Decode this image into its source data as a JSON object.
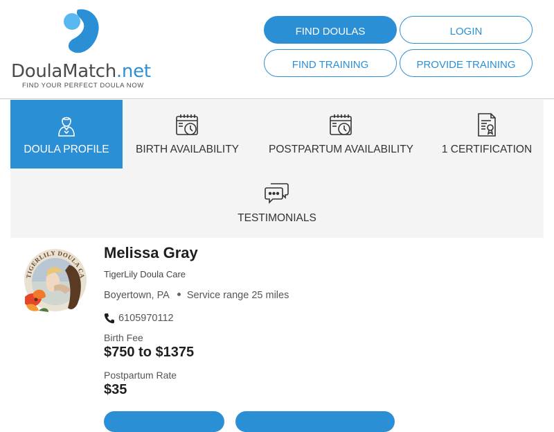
{
  "header": {
    "logo": {
      "text_part1": "Doula",
      "text_part2": "Match",
      "text_part3": ".net",
      "tagline": "FIND YOUR PERFECT DOULA NOW"
    },
    "nav": {
      "find_doulas": "FIND DOULAS",
      "login": "LOGIN",
      "find_training": "FIND TRAINING",
      "provide_training": "PROVIDE TRAINING"
    }
  },
  "tabs": [
    {
      "label": "DOULA PROFILE",
      "icon": "doula-person-icon",
      "active": true
    },
    {
      "label": "BIRTH AVAILABILITY",
      "icon": "calendar-clock-icon",
      "active": false
    },
    {
      "label": "POSTPARTUM AVAILABILITY",
      "icon": "calendar-clock-icon",
      "active": false
    },
    {
      "label": "1 CERTIFICATION",
      "icon": "certificate-icon",
      "active": false
    },
    {
      "label": "TESTIMONIALS",
      "icon": "chat-bubbles-icon",
      "active": false
    }
  ],
  "profile": {
    "name": "Melissa Gray",
    "company": "TigerLily Doula Care",
    "logo_text": "TIGERLILY DOULA CARE",
    "location": "Boyertown, PA",
    "service_range": "Service range 25 miles",
    "phone": "6105970112",
    "birth_fee_label": "Birth Fee",
    "birth_fee": "$750 to $1375",
    "postpartum_label": "Postpartum Rate",
    "postpartum_rate": "$35"
  },
  "colors": {
    "accent": "#2b8fd6",
    "tab_bg": "#f4f4f4",
    "text_dark": "#1e1e1e"
  }
}
